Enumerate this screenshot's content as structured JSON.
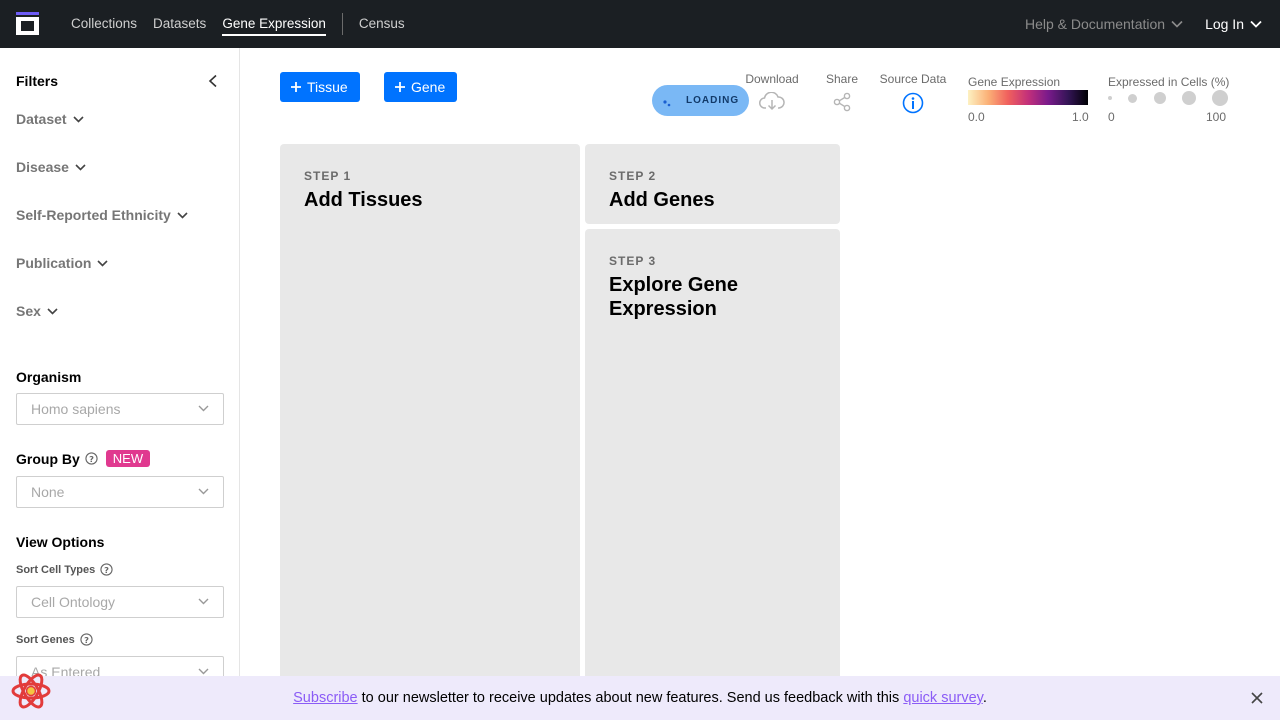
{
  "nav": {
    "links": [
      "Collections",
      "Datasets",
      "Gene Expression"
    ],
    "census": "Census",
    "help": "Help & Documentation",
    "login": "Log In"
  },
  "sidebar": {
    "title": "Filters",
    "filters": [
      "Dataset",
      "Disease",
      "Self-Reported Ethnicity",
      "Publication",
      "Sex"
    ],
    "organism": {
      "label": "Organism",
      "value": "Homo sapiens"
    },
    "group_by": {
      "label": "Group By",
      "badge": "NEW",
      "value": "None"
    },
    "view_options": {
      "label": "View Options",
      "sort_cell_types": {
        "label": "Sort Cell Types",
        "value": "Cell Ontology"
      },
      "sort_genes": {
        "label": "Sort Genes",
        "value": "As Entered"
      }
    }
  },
  "toolbar": {
    "tissue_btn": "Tissue",
    "gene_btn": "Gene",
    "loading": "LOADING",
    "download": "Download",
    "share": "Share",
    "source_data": "Source Data",
    "gene_expression": {
      "title": "Gene Expression",
      "min": "0.0",
      "max": "1.0"
    },
    "expressed_cells": {
      "title": "Expressed in Cells (%)",
      "min": "0",
      "max": "100"
    }
  },
  "steps": [
    {
      "label": "STEP 1",
      "title": "Add Tissues"
    },
    {
      "label": "STEP 2",
      "title": "Add Genes"
    },
    {
      "label": "STEP 3",
      "title": "Explore Gene Expression"
    }
  ],
  "banner": {
    "subscribe": "Subscribe",
    "text": " to our newsletter to receive updates about new features. Send us feedback with this ",
    "survey": "quick survey",
    "end": "."
  },
  "colors": {
    "nav_bg": "#1b1f23",
    "primary": "#0073ff",
    "new_badge": "#e0398f",
    "banner_bg": "#eeeafb",
    "link": "#8b5cf6"
  }
}
